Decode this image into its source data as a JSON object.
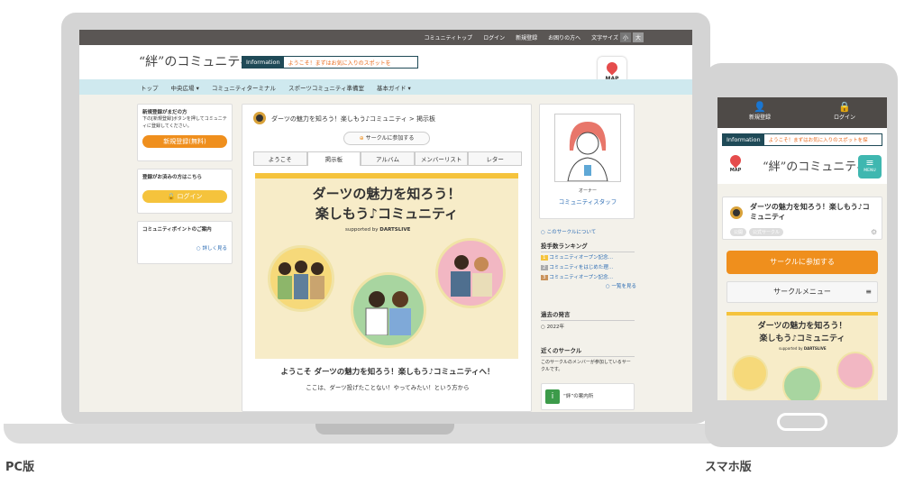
{
  "captions": {
    "pc": "PC版",
    "sp": "スマホ版"
  },
  "pc": {
    "topbar": [
      "コミュニティトップ",
      "ログイン",
      "新規登録",
      "お困りの方へ",
      "文字サイズ"
    ],
    "size_small": "小",
    "size_large": "大",
    "logo": "“絆”のコミュニティ",
    "info_label": "Information",
    "info_text": "ようこそ！まずはお気に入りのスポットを",
    "map": "MAP",
    "nav": [
      "トップ",
      "中央広場 ▾",
      "コミュニティターミナル",
      "スポーツコミュニティ準備室",
      "基本ガイド ▾"
    ],
    "left": {
      "new_title": "新規登録がまだの方",
      "new_desc": "下の[新規登録]ボタンを押してコミュニティに登録してください。",
      "new_btn": "新規登録(無料)",
      "login_title": "登録がお済みの方はこちら",
      "login_btn": "ログイン",
      "points_title": "コミュニティポイントのご案内",
      "points_link": "詳しく見る"
    },
    "main": {
      "crumb": "ダーツの魅力を知ろう！楽しもう♪コミュニティ > 掲示板",
      "join": "サークルに参加する",
      "tabs": [
        "ようこそ",
        "掲示板",
        "アルバム",
        "メンバーリスト",
        "レター"
      ],
      "banner_title1": "ダーツの魅力を知ろう！",
      "banner_title2": "楽しもう♪コミュニティ",
      "supported": "supported by",
      "brand": "DARTSLIVE",
      "welcome": "ようこそ  ダーツの魅力を知ろう！楽しもう♪コミュニティへ！",
      "desc": "ここは、ダーツ投げたことない！やってみたい！という方から"
    },
    "right": {
      "owner_label": "オーナー",
      "owner_name": "コミュニティスタッフ",
      "about": "このサークルについて",
      "ranking_title": "投手数ランキング",
      "ranking": [
        "コミュニティオープン記念…",
        "コミュニティをはじめた理…",
        "コミュニティオープン記念…"
      ],
      "ranking_more": "一覧を見る",
      "past_title": "過去の発言",
      "past_year": "2022年",
      "near_title": "近くのサークル",
      "near_desc": "このサークルのメンバーが参加しているサークルです。",
      "guide": "“絆”の案内所"
    }
  },
  "sp": {
    "new_label": "新規登録",
    "login_label": "ログイン",
    "info_label": "Information",
    "info_text": "ようこそ！まずはお気に入りのスポットを探",
    "map": "MAP",
    "logo": "“絆”のコミュニティ",
    "menu": "MENU",
    "title": "ダーツの魅力を知ろう！楽しもう♪コミュニティ",
    "tags": [
      "公開",
      "公式サークル"
    ],
    "join": "サークルに参加する",
    "circle_menu": "サークルメニュー",
    "banner_title1": "ダーツの魅力を知ろう！",
    "banner_title2": "楽しもう♪コミュニティ",
    "supported": "supported by",
    "brand": "DARTSLIVE"
  },
  "colors": {
    "orange": "#ef8f1d",
    "yellow": "#f5c33c",
    "navy": "#1f4a57",
    "nav_bg": "#cfe9ef",
    "dark_bar": "#5a5654"
  },
  "icons": [
    "user-plus-icon",
    "lock-icon",
    "map-pin-icon",
    "menu-icon",
    "dartboard-icon",
    "gear-icon",
    "info-icon"
  ]
}
